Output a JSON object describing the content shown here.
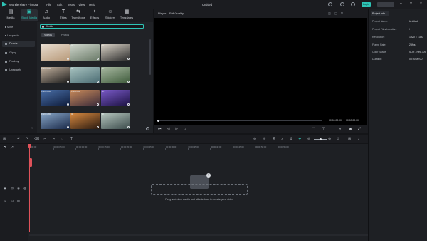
{
  "app": {
    "name": "Wondershare Filmora",
    "doc_title": "Untitled",
    "menu": [
      "File",
      "Edit",
      "Tools",
      "View",
      "Help"
    ],
    "login_label": "Login"
  },
  "media_toolbar": [
    {
      "label": "Media",
      "icon": "media-icon"
    },
    {
      "label": "Stock Media",
      "icon": "stock-media-icon",
      "active": true
    },
    {
      "label": "Audio",
      "icon": "audio-icon"
    },
    {
      "label": "Titles",
      "icon": "titles-icon"
    },
    {
      "label": "Transitions",
      "icon": "transitions-icon"
    },
    {
      "label": "Effects",
      "icon": "effects-icon"
    },
    {
      "label": "Stickers",
      "icon": "stickers-icon"
    },
    {
      "label": "Templates",
      "icon": "templates-icon"
    }
  ],
  "left_nav": {
    "items": [
      "Mine",
      "Unsplash",
      "Pexels",
      "Giphy",
      "Pixabay",
      "Unsplash"
    ],
    "active_index": 2
  },
  "media": {
    "search_value": "florida",
    "tabs": [
      "Videos",
      "Photos"
    ],
    "active_tab": 0,
    "thumbnails": [
      {
        "label": "4K",
        "colors": [
          "#b89a7a",
          "#e8ddd0"
        ]
      },
      {
        "label": "4K",
        "colors": [
          "#6a7a68",
          "#cfd6cc"
        ]
      },
      {
        "label": "4K",
        "colors": [
          "#2c2c2c",
          "#d9d2c6"
        ]
      },
      {
        "label": "1920×1080",
        "colors": [
          "#1a1a1a",
          "#c4b3a0"
        ]
      },
      {
        "label": "4K",
        "colors": [
          "#4a6b72",
          "#a8c3c0"
        ]
      },
      {
        "label": "4K",
        "colors": [
          "#3d5a3a",
          "#a9b9a2"
        ]
      },
      {
        "label": "1920×1080",
        "colors": [
          "#0d1b3a",
          "#4a6fa8"
        ]
      },
      {
        "label": "1920×1080",
        "colors": [
          "#3a2a3a",
          "#c88a5a"
        ]
      },
      {
        "label": "4K",
        "colors": [
          "#1a1040",
          "#7a5ac8"
        ]
      },
      {
        "label": "1920×1080",
        "colors": [
          "#1a2a4a",
          "#8aa8c8"
        ]
      },
      {
        "label": "4K",
        "colors": [
          "#2a1a10",
          "#d88a40"
        ]
      },
      {
        "label": "4K",
        "colors": [
          "#3a4a4a",
          "#b8c8c0"
        ]
      }
    ]
  },
  "player": {
    "label": "Player",
    "quality": "Full Quality",
    "time_current": "00:00:00:00",
    "time_total": "00:00:00:00"
  },
  "project_info": {
    "tab": "Project Info",
    "rows": [
      {
        "key": "Project Name:",
        "value": "Untitled"
      },
      {
        "key": "Project Files Location:",
        "value": "/"
      },
      {
        "key": "Resolution:",
        "value": "1920 × 1080"
      },
      {
        "key": "Frame Rate:",
        "value": "25fps"
      },
      {
        "key": "Color Space:",
        "value": "SDR - Rec.709"
      },
      {
        "key": "Duration:",
        "value": "00:00:00:00"
      }
    ]
  },
  "timeline": {
    "ruler": [
      "00:00",
      "00:00:05:00",
      "00:00:10:00",
      "00:00:15:00",
      "00:00:20:00",
      "00:00:25:00",
      "00:00:30:00",
      "00:00:35:00",
      "00:00:40:00",
      "00:00:45:00",
      "00:00:50:00",
      "00:00:55:00"
    ],
    "drop_hint": "Drag and drop media and effects here to create your video"
  }
}
